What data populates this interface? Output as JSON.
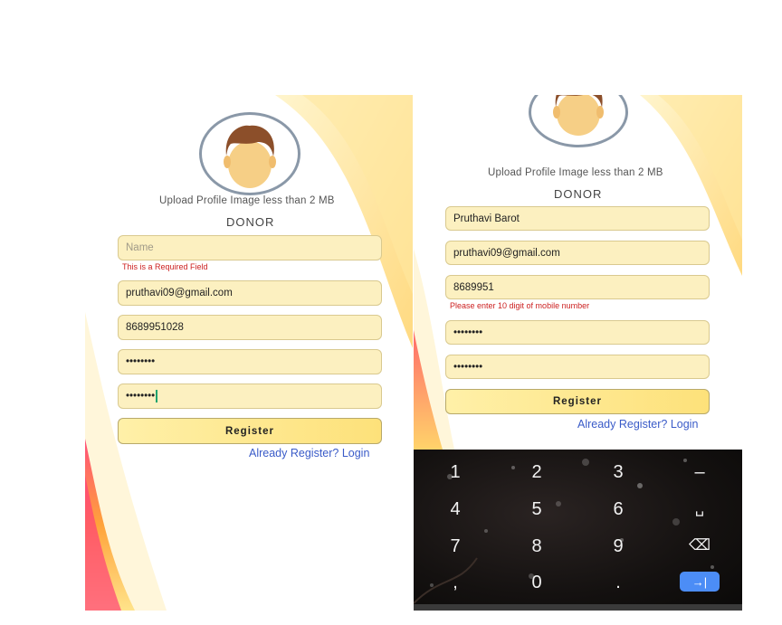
{
  "left": {
    "upload_text": "Upload Profile Image less than 2 MB",
    "role": "DONOR",
    "name_placeholder": "Name",
    "name_error": "This is a Required Field",
    "email": "pruthavi09@gmail.com",
    "mobile": "8689951028",
    "password": "••••••••",
    "confirm_password": "••••••••",
    "register_label": "Register",
    "login_link": "Already Register? Login"
  },
  "right": {
    "upload_text": "Upload Profile Image less than 2 MB",
    "role": "DONOR",
    "name": "Pruthavi Barot",
    "email": "pruthavi09@gmail.com",
    "mobile": "8689951",
    "mobile_error": "Please enter 10 digit of mobile number",
    "password": "••••••••",
    "confirm_password": "••••••••",
    "register_label": "Register",
    "login_link": "Already Register? Login"
  },
  "keyboard": {
    "keys": {
      "k1": "1",
      "k2": "2",
      "k3": "3",
      "dash": "–",
      "k4": "4",
      "k5": "5",
      "k6": "6",
      "space": "␣",
      "k7": "7",
      "k8": "8",
      "k9": "9",
      "backspace": "⌫",
      "comma": ",",
      "k0": "0",
      "period": ".",
      "tab": "→|"
    }
  },
  "colors": {
    "field_bg": "#fcf0c0",
    "button_bg": "#fde17a",
    "link": "#3a5bc8",
    "error": "#cc1f1f",
    "tab_key": "#4c8df6"
  }
}
